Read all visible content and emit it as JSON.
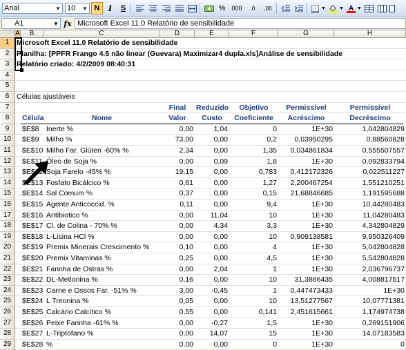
{
  "toolbar": {
    "font_name": "Arial",
    "font_size": "10",
    "bold_label": "N",
    "italic_label": "I",
    "underline_label": "S",
    "percent_label": "%",
    "thousands_label": "000",
    "inc_decimal_label": ",0",
    "dec_decimal_label": ",00"
  },
  "formula_bar": {
    "cell_ref": "A1",
    "fx": "fx",
    "content": "Microsoft Excel 11.0 Relatório de sensibilidade"
  },
  "columns": [
    "A",
    "B",
    "C",
    "D",
    "E",
    "F",
    "G",
    "H"
  ],
  "rows": [
    "1",
    "2",
    "3",
    "4",
    "5",
    "6",
    "7",
    "8",
    "9",
    "10",
    "11",
    "12",
    "13",
    "14",
    "15",
    "16",
    "17",
    "18",
    "19",
    "20",
    "21",
    "22",
    "23",
    "24",
    "25",
    "26",
    "27",
    "28",
    "29"
  ],
  "report": {
    "title": "Microsoft Excel 11.0 Relatório de sensibilidade",
    "sheet": "Planilha: [PPFR Frango 4.5 não linear (Guevara) Maximizar4 dupla.xls]Análise de sensibilidade",
    "created": "Relatório criado: 4/2/2009 08:40:31",
    "section": "Células ajustáveis"
  },
  "headers": {
    "row7": [
      "",
      "",
      "Final",
      "Reduzido",
      "Objetivo",
      "Permissível",
      "Permissível"
    ],
    "row8": [
      "Célula",
      "Nome",
      "Valor",
      "Custo",
      "Coeficiente",
      "Acréscimo",
      "Decréscimo"
    ]
  },
  "table": [
    {
      "cell": "$E$8",
      "name": "Inerte %",
      "final": "0,00",
      "reduced": "1,04",
      "obj": "0",
      "inc": "1E+30",
      "dec": "1,042804829"
    },
    {
      "cell": "$E$9",
      "name": "Milho %",
      "final": "73,00",
      "reduced": "0,00",
      "obj": "0,2",
      "inc": "0,03950295",
      "dec": "0,88560828"
    },
    {
      "cell": "$E$10",
      "name": "Milho Far. Glúten -60% %",
      "final": "2,34",
      "reduced": "0,00",
      "obj": "1,35",
      "inc": "0,034861834",
      "dec": "0,555507557"
    },
    {
      "cell": "$E$11",
      "name": "Óleo de Soja %",
      "final": "0,00",
      "reduced": "0,09",
      "obj": "1,8",
      "inc": "1E+30",
      "dec": "0,092833794"
    },
    {
      "cell": "$E$12",
      "name": "Soja Farelo -45% %",
      "final": "19,15",
      "reduced": "0,00",
      "obj": "0,783",
      "inc": "0,412172326",
      "dec": "0,022511227"
    },
    {
      "cell": "$E$13",
      "name": "Fosfato Bicálcico %",
      "final": "0,61",
      "reduced": "0,00",
      "obj": "1,27",
      "inc": "2,200467254",
      "dec": "1,551210251"
    },
    {
      "cell": "$E$14",
      "name": "Sal Comum %",
      "final": "0,37",
      "reduced": "0,00",
      "obj": "0,15",
      "inc": "21,68846685",
      "dec": "1,191595688"
    },
    {
      "cell": "$E$15",
      "name": "Agente Anticoccid. %",
      "final": "0,11",
      "reduced": "0,00",
      "obj": "9,4",
      "inc": "1E+30",
      "dec": "10,44280483"
    },
    {
      "cell": "$E$16",
      "name": "Antibiotico %",
      "final": "0,00",
      "reduced": "11,04",
      "obj": "10",
      "inc": "1E+30",
      "dec": "11,04280483"
    },
    {
      "cell": "$E$17",
      "name": "Cl. de Colina - 70% %",
      "final": "0,00",
      "reduced": "4,34",
      "obj": "3,3",
      "inc": "1E+30",
      "dec": "4,342804829"
    },
    {
      "cell": "$E$18",
      "name": "L-Lisina HCl %",
      "final": "0,00",
      "reduced": "0,00",
      "obj": "10",
      "inc": "0,909138581",
      "dec": "9,950326409"
    },
    {
      "cell": "$E$19",
      "name": "Premix Minerais Crescimento %",
      "final": "0,10",
      "reduced": "0,00",
      "obj": "4",
      "inc": "1E+30",
      "dec": "5,042804828"
    },
    {
      "cell": "$E$20",
      "name": "Premix Vitaminas %",
      "final": "0,25",
      "reduced": "0,00",
      "obj": "4,5",
      "inc": "1E+30",
      "dec": "5,542804828"
    },
    {
      "cell": "$E$21",
      "name": "Farinha de Ostras %",
      "final": "0,00",
      "reduced": "2,04",
      "obj": "1",
      "inc": "1E+30",
      "dec": "2,036796737"
    },
    {
      "cell": "$E$22",
      "name": "DL-Metionina %",
      "final": "0,16",
      "reduced": "0,00",
      "obj": "10",
      "inc": "31,3866435",
      "dec": "4,008817517"
    },
    {
      "cell": "$E$23",
      "name": "Carne e Ossos Far. -51% %",
      "final": "3,00",
      "reduced": "-0,45",
      "obj": "1",
      "inc": "0,447473433",
      "dec": "1E+30"
    },
    {
      "cell": "$E$24",
      "name": "L Treonina %",
      "final": "0,05",
      "reduced": "0,00",
      "obj": "10",
      "inc": "13,51277567",
      "dec": "10,07771381"
    },
    {
      "cell": "$E$25",
      "name": "Calcário Calcítico %",
      "final": "0,55",
      "reduced": "0,00",
      "obj": "0,141",
      "inc": "2,451615661",
      "dec": "1,174974738"
    },
    {
      "cell": "$E$26",
      "name": "Peixe Farinha -61% %",
      "final": "0,00",
      "reduced": "-0,27",
      "obj": "1,5",
      "inc": "1E+30",
      "dec": "0,269151906"
    },
    {
      "cell": "$E$27",
      "name": "L-Triptofano %",
      "final": "0,00",
      "reduced": "14,07",
      "obj": "15",
      "inc": "1E+30",
      "dec": "14,07183583"
    },
    {
      "cell": "$E$28",
      "name": "%",
      "final": "0,00",
      "reduced": "0,00",
      "obj": "0",
      "inc": "1E+30",
      "dec": "0"
    }
  ]
}
